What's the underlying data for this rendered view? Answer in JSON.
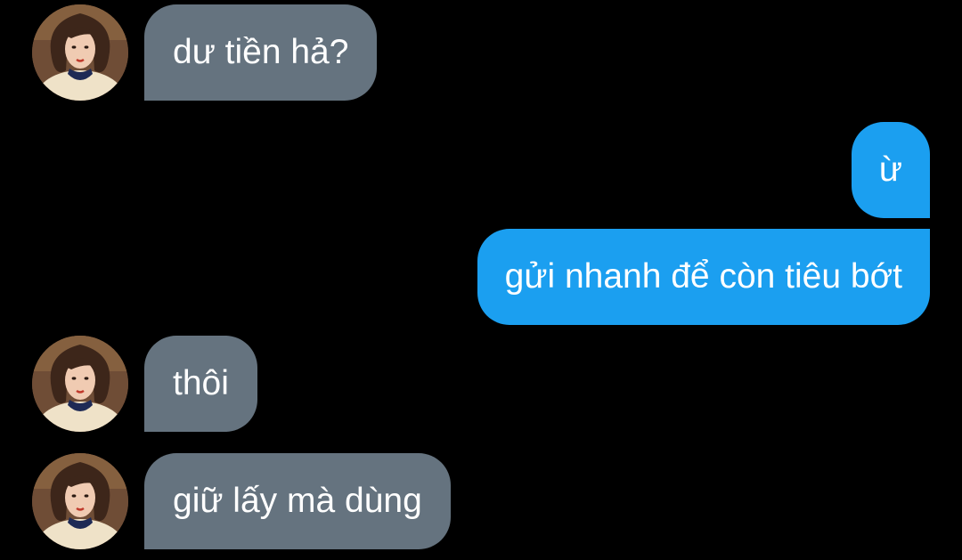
{
  "conversation": {
    "messages": [
      {
        "sender": "contact",
        "text": "dư tiền hả?"
      },
      {
        "sender": "me",
        "text": "ừ"
      },
      {
        "sender": "me",
        "text": "gửi nhanh để còn tiêu bớt"
      },
      {
        "sender": "contact",
        "text": "thôi"
      },
      {
        "sender": "contact",
        "text": "giữ lấy mà dùng"
      }
    ]
  },
  "colors": {
    "background": "#000000",
    "incoming_bubble": "#65737f",
    "outgoing_bubble": "#1b9ff0",
    "text": "#ffffff"
  },
  "icons": {
    "contact_avatar": "profile-photo"
  }
}
